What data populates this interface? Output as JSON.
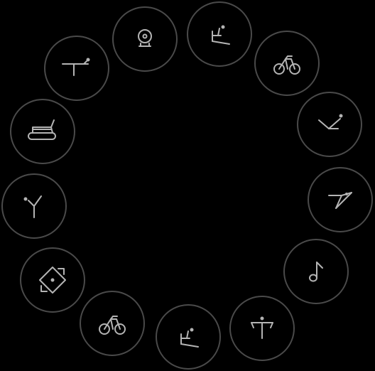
{
  "theme": {
    "background": "#000000",
    "ring_stroke": "#4a4a4a",
    "icon_stroke": "#b4b4b4"
  },
  "workout_wheel": {
    "items": [
      {
        "id": "sit-ups",
        "icon": "sit-up-icon"
      },
      {
        "id": "cycling-1",
        "icon": "bicycle-icon"
      },
      {
        "id": "v-ups",
        "icon": "v-up-icon"
      },
      {
        "id": "leg-raise",
        "icon": "leg-raise-icon"
      },
      {
        "id": "dance",
        "icon": "music-note-icon"
      },
      {
        "id": "t-stretch",
        "icon": "t-stretch-icon"
      },
      {
        "id": "sit-ups-2",
        "icon": "sit-up-icon"
      },
      {
        "id": "cycling-2",
        "icon": "bicycle-icon"
      },
      {
        "id": "rotation",
        "icon": "rotation-diamond-icon"
      },
      {
        "id": "y-raise",
        "icon": "y-raise-icon"
      },
      {
        "id": "treadmill",
        "icon": "treadmill-icon"
      },
      {
        "id": "plank-table",
        "icon": "plank-table-icon"
      },
      {
        "id": "webcam",
        "icon": "webcam-icon"
      }
    ]
  }
}
